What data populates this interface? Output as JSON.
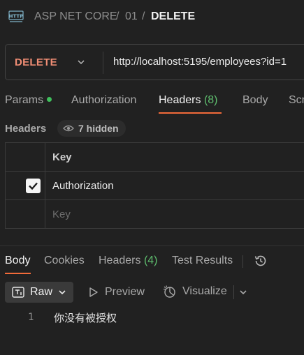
{
  "breadcrumb": {
    "icon": "http-request-icon",
    "items": [
      "ASP NET CORE",
      "01",
      "DELETE"
    ],
    "separator": "/"
  },
  "request": {
    "method": "DELETE",
    "url": "http://localhost:5195/employees?id=1"
  },
  "request_tabs": {
    "params": "Params",
    "authorization": "Authorization",
    "headers": "Headers",
    "headers_count": "(8)",
    "body": "Body",
    "scripts": "Scri"
  },
  "headers_section": {
    "label": "Headers",
    "hidden": "7 hidden",
    "key_column": "Key",
    "rows": [
      {
        "key": "Authorization",
        "checked": true
      }
    ],
    "placeholder": "Key"
  },
  "response_tabs": {
    "body": "Body",
    "cookies": "Cookies",
    "headers": "Headers",
    "headers_count": "(4)",
    "test_results": "Test Results"
  },
  "response_view": {
    "raw": "Raw",
    "preview": "Preview",
    "visualize": "Visualize"
  },
  "response_body": {
    "line_number": "1",
    "content": "你没有被授权"
  },
  "colors": {
    "accent": "#f26b3a",
    "method_delete": "#f08d74",
    "green": "#3fbf5c"
  }
}
